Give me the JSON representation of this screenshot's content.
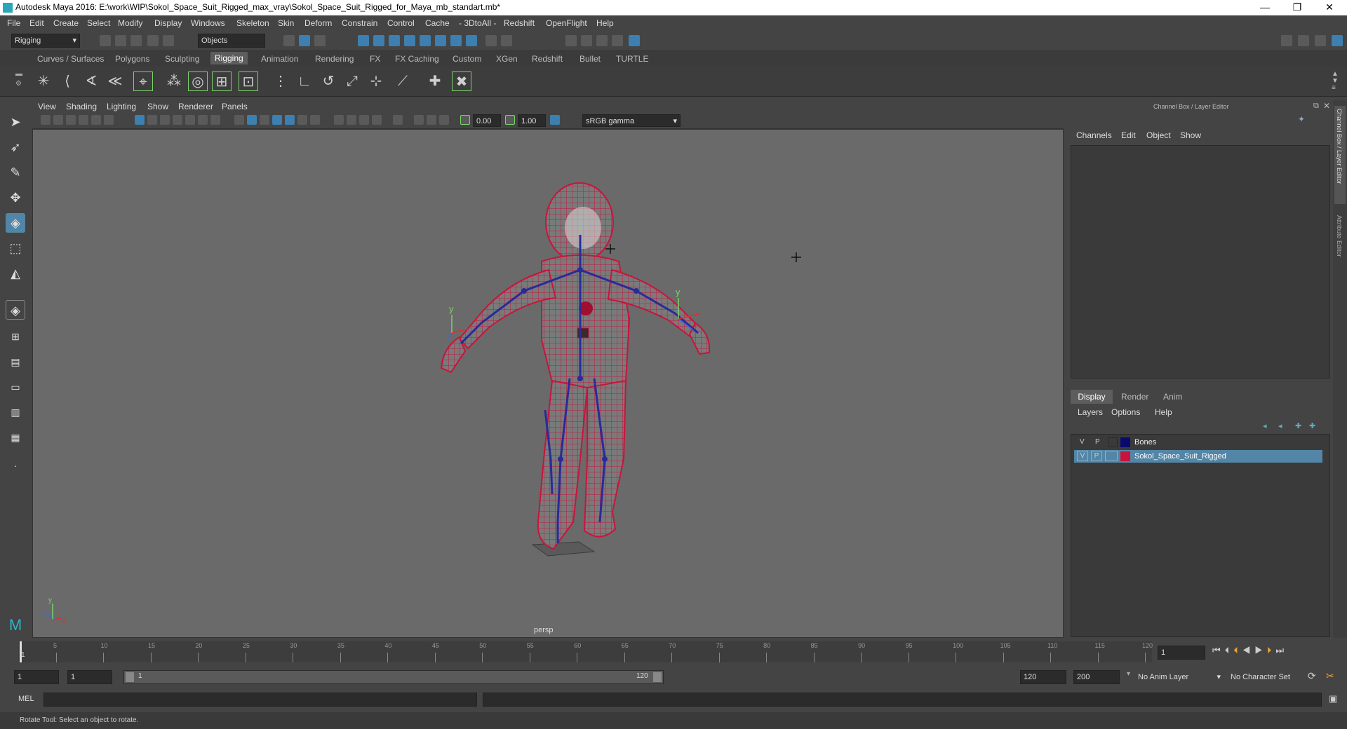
{
  "title_bar": {
    "title": "Autodesk Maya 2016: E:\\work\\WIP\\Sokol_Space_Suit_Rigged_max_vray\\Sokol_Space_Suit_Rigged_for_Maya_mb_standart.mb*"
  },
  "menu": [
    "File",
    "Edit",
    "Create",
    "Select",
    "Modify",
    "Display",
    "Windows",
    "Skeleton",
    "Skin",
    "Deform",
    "Constrain",
    "Control",
    "Cache",
    "- 3DtoAll -",
    "Redshift",
    "OpenFlight",
    "Help"
  ],
  "status_line": {
    "menu_set": "Rigging",
    "selection_mode": "Objects"
  },
  "shelf_tabs": [
    "Curves / Surfaces",
    "Polygons",
    "Sculpting",
    "Rigging",
    "Animation",
    "Rendering",
    "FX",
    "FX Caching",
    "Custom",
    "XGen",
    "Redshift",
    "Bullet",
    "TURTLE"
  ],
  "active_shelf_tab": "Rigging",
  "viewport": {
    "menu": [
      "View",
      "Shading",
      "Lighting",
      "Show",
      "Renderer",
      "Panels"
    ],
    "exposure": "0.00",
    "gamma": "1.00",
    "color_space": "sRGB gamma",
    "camera_label": "persp",
    "axis_y": "y",
    "axis_x": "x",
    "axis_z": "z"
  },
  "channel_box": {
    "title": "Channel Box / Layer Editor",
    "menu": [
      "Channels",
      "Edit",
      "Object",
      "Show"
    ],
    "layer_tabs": [
      "Display",
      "Render",
      "Anim"
    ],
    "layer_menu": [
      "Layers",
      "Options",
      "Help"
    ],
    "layers": [
      {
        "v": "V",
        "p": "P",
        "color": "#0a0a6e",
        "name": "Bones",
        "selected": false
      },
      {
        "v": "V",
        "p": "P",
        "color": "#c8143c",
        "name": "Sokol_Space_Suit_Rigged",
        "selected": true
      }
    ],
    "side_tabs": [
      "Channel Box / Layer Editor",
      "Attribute Editor"
    ]
  },
  "time_slider": {
    "tick_labels": [
      "5",
      "10",
      "15",
      "20",
      "25",
      "30",
      "35",
      "40",
      "45",
      "50",
      "55",
      "60",
      "65",
      "70",
      "75",
      "80",
      "85",
      "90",
      "95",
      "100",
      "105",
      "110",
      "115",
      "120"
    ],
    "current_frame": "1",
    "start_marker": "1"
  },
  "range_slider": {
    "start_time": "1",
    "playback_start": "1",
    "range_start_label": "1",
    "range_end_label": "120",
    "playback_end": "120",
    "end_time": "200",
    "anim_layer": "No Anim Layer",
    "character_set": "No Character Set"
  },
  "command_line": {
    "label": "MEL"
  },
  "help_line": {
    "text": "Rotate Tool: Select an object to rotate."
  },
  "colors": {
    "suit": "#c8143c",
    "bones": "#2a2a9a",
    "selection": "#5285a6",
    "active_tool": "#5285a6"
  }
}
